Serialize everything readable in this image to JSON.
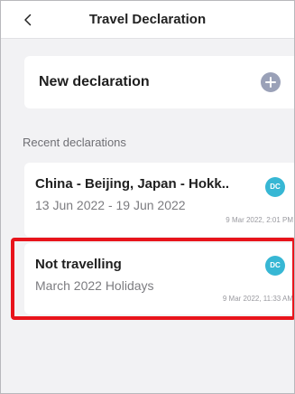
{
  "header": {
    "title": "Travel Declaration",
    "back_icon": "chevron-left-icon"
  },
  "new_declaration": {
    "label": "New declaration",
    "icon": "plus-circle-icon",
    "icon_color": "#9aa1b8"
  },
  "recent": {
    "section_label": "Recent declarations",
    "items": [
      {
        "title": "China - Beijing, Japan - Hokk..",
        "subtitle": "13 Jun 2022 - 19 Jun 2022",
        "avatar": "DC",
        "timestamp": "9 Mar 2022, 2:01 PM"
      },
      {
        "title": "Not travelling",
        "subtitle": "March 2022 Holidays",
        "avatar": "DC",
        "timestamp": "9 Mar 2022, 11:33 AM"
      }
    ]
  },
  "colors": {
    "background": "#f2f2f4",
    "avatar": "#37b7d4",
    "highlight": "#e8141b"
  }
}
